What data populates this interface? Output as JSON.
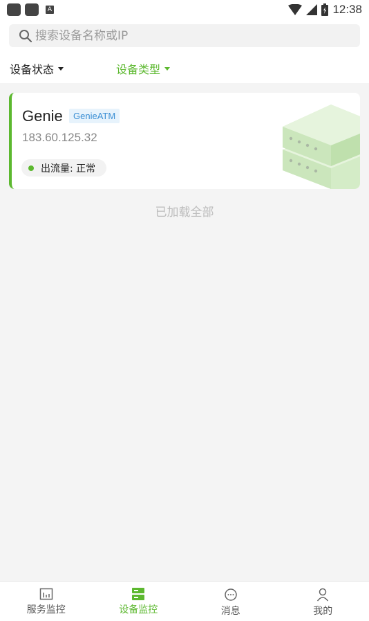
{
  "status_bar": {
    "time": "12:38",
    "notification_letter": "A"
  },
  "search": {
    "placeholder": "搜索设备名称或IP",
    "value": ""
  },
  "filters": [
    {
      "label": "设备状态",
      "active": false
    },
    {
      "label": "设备类型",
      "active": true
    }
  ],
  "device": {
    "name": "Genie",
    "tag": "GenieATM",
    "ip": "183.60.125.32",
    "status": "出流量: 正常"
  },
  "list_footer": "已加载全部",
  "tabs": [
    {
      "label": "服务监控",
      "icon": "bar-chart-icon",
      "active": false
    },
    {
      "label": "设备监控",
      "icon": "server-icon",
      "active": true
    },
    {
      "label": "消息",
      "icon": "chat-bubble-icon",
      "active": false
    },
    {
      "label": "我的",
      "icon": "person-icon",
      "active": false
    }
  ],
  "colors": {
    "accent": "#5cb82f",
    "tag_text": "#3b8fd4",
    "tag_bg": "#e7f3fc",
    "background": "#f4f4f4"
  }
}
